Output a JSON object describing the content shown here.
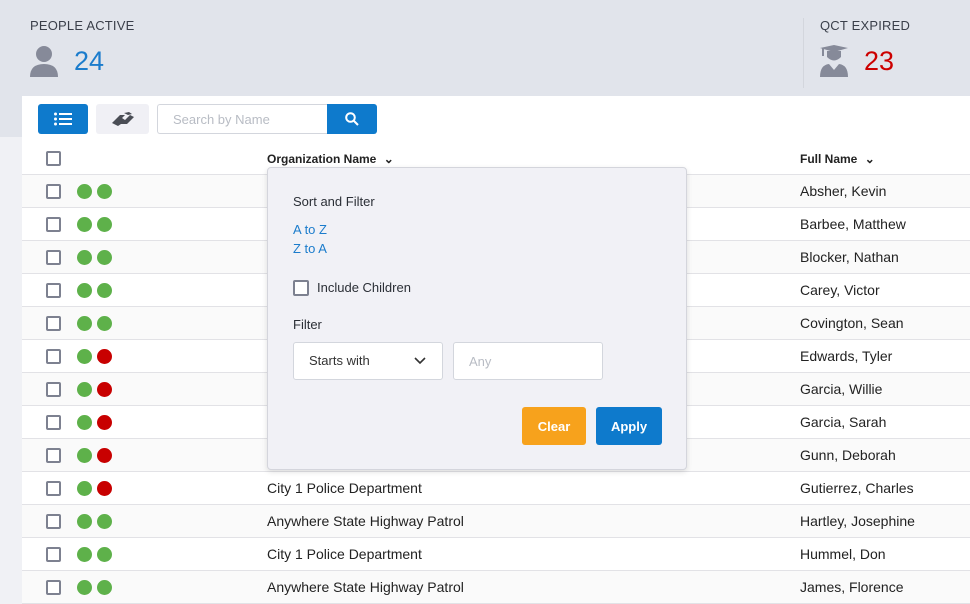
{
  "stats": [
    {
      "label": "PEOPLE ACTIVE",
      "value": "24",
      "icon": "person-icon",
      "color": "#1b7ccc"
    },
    {
      "label": "QCT EXPIRED",
      "value": "23",
      "icon": "graduate-icon",
      "color": "#cc0000"
    }
  ],
  "toolbar": {
    "list_icon": "list-icon",
    "link_icon": "handshake-icon",
    "search_placeholder": "Search by Name",
    "search_icon": "search-icon"
  },
  "columns": {
    "org": "Organization Name",
    "name": "Full Name"
  },
  "colors": {
    "accent": "#0e7acc",
    "green": "#5eb14a",
    "red": "#c80000",
    "clear": "#f7a21c"
  },
  "rows": [
    {
      "s1": "green",
      "s2": "green",
      "org": "",
      "name": "Absher, Kevin"
    },
    {
      "s1": "green",
      "s2": "green",
      "org": "",
      "name": "Barbee, Matthew"
    },
    {
      "s1": "green",
      "s2": "green",
      "org": "",
      "name": "Blocker, Nathan"
    },
    {
      "s1": "green",
      "s2": "green",
      "org": "",
      "name": "Carey, Victor"
    },
    {
      "s1": "green",
      "s2": "green",
      "org": "",
      "name": "Covington, Sean"
    },
    {
      "s1": "green",
      "s2": "red",
      "org": "",
      "name": "Edwards, Tyler"
    },
    {
      "s1": "green",
      "s2": "red",
      "org": "",
      "name": "Garcia, Willie"
    },
    {
      "s1": "green",
      "s2": "red",
      "org": "",
      "name": "Garcia, Sarah"
    },
    {
      "s1": "green",
      "s2": "red",
      "org": "",
      "name": "Gunn, Deborah"
    },
    {
      "s1": "green",
      "s2": "red",
      "org": "City 1 Police Department",
      "name": "Gutierrez, Charles"
    },
    {
      "s1": "green",
      "s2": "green",
      "org": "Anywhere State Highway Patrol",
      "name": "Hartley, Josephine"
    },
    {
      "s1": "green",
      "s2": "green",
      "org": "City 1 Police Department",
      "name": "Hummel, Don"
    },
    {
      "s1": "green",
      "s2": "green",
      "org": "Anywhere State Highway Patrol",
      "name": "James, Florence"
    }
  ],
  "popover": {
    "title": "Sort and Filter",
    "sort_az": "A to Z",
    "sort_za": "Z to A",
    "include_children": "Include Children",
    "include_children_checked": false,
    "filter_label": "Filter",
    "filter_mode": "Starts with",
    "filter_placeholder": "Any",
    "clear": "Clear",
    "apply": "Apply"
  }
}
